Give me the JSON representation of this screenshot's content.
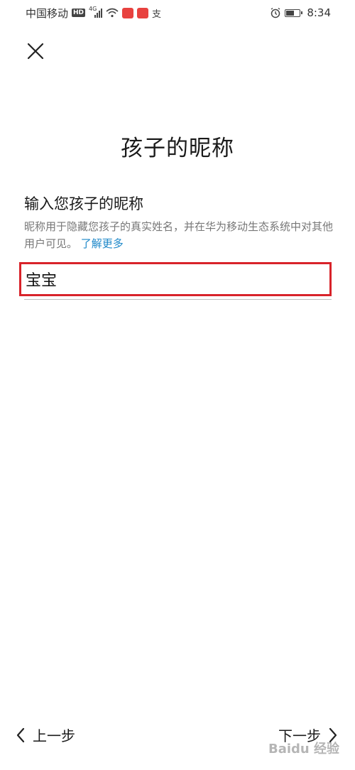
{
  "status_bar": {
    "carrier": "中国移动",
    "hd": "HD",
    "network": "4G",
    "time": "8:34",
    "icons": [
      "hd-icon",
      "signal-icon",
      "wifi-icon",
      "app-notification-icon",
      "app-notification-icon",
      "alipay-icon",
      "alarm-icon",
      "battery-icon"
    ]
  },
  "header": {
    "close_icon": "close-icon"
  },
  "page": {
    "title": "孩子的昵称",
    "heading": "输入您孩子的昵称",
    "description": "昵称用于隐藏您孩子的真实姓名，并在华为移动生态系统中对其他用户可见。",
    "learn_more": "了解更多"
  },
  "nickname_input": {
    "value": "宝宝",
    "placeholder": ""
  },
  "footer": {
    "prev_label": "上一步",
    "next_label": "下一步"
  },
  "watermark": {
    "text": "Baidu 经验"
  },
  "colors": {
    "accent_link": "#1e88c9",
    "highlight_border": "#d8232a"
  }
}
